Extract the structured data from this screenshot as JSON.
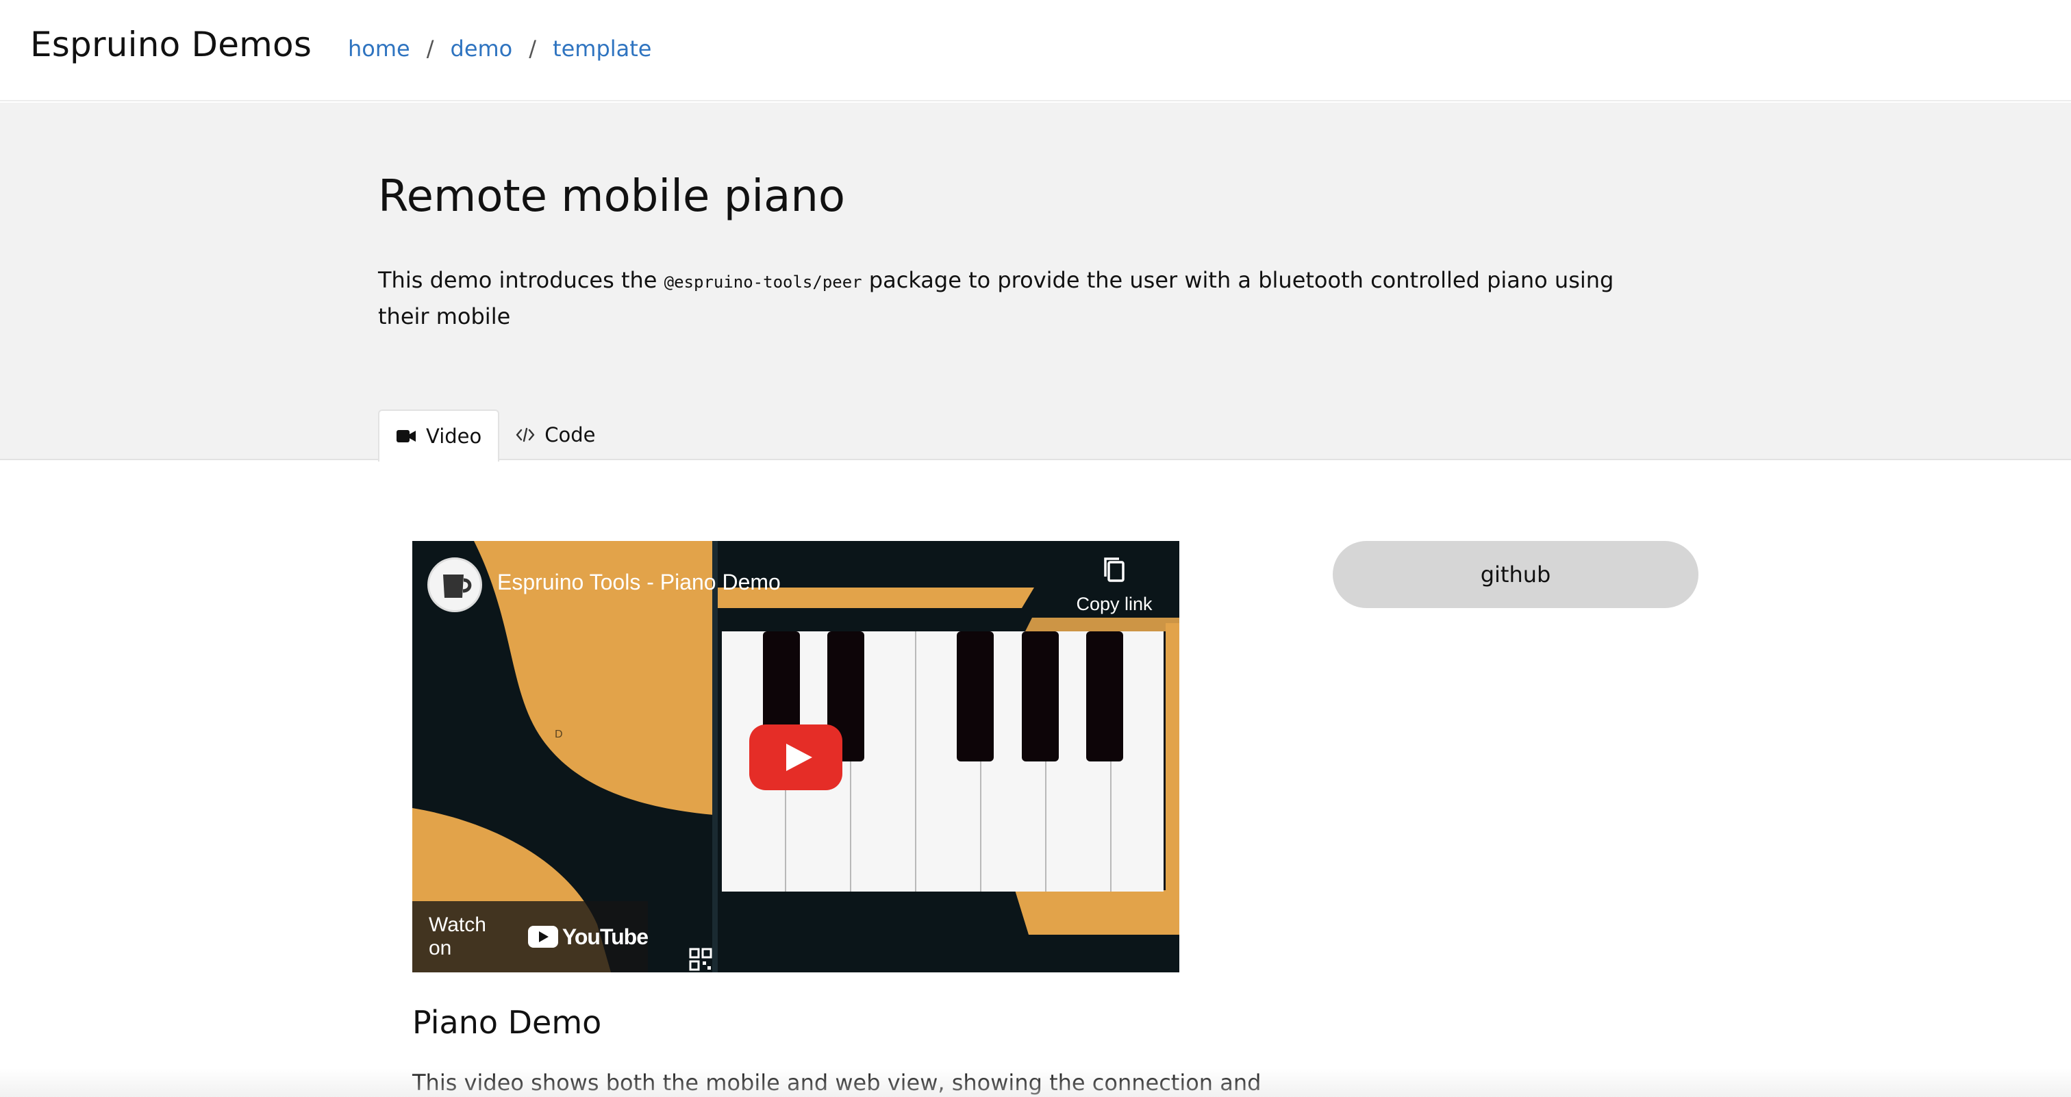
{
  "header": {
    "brand": "Espruino Demos",
    "breadcrumb": [
      {
        "label": "home"
      },
      {
        "label": "demo"
      },
      {
        "label": "template"
      }
    ],
    "separator": "/"
  },
  "hero": {
    "title": "Remote mobile piano",
    "intro_before": "This demo introduces the ",
    "intro_code": "@espruino-tools/peer",
    "intro_after": " package to provide the user with a bluetooth controlled piano using their mobile"
  },
  "tabs": [
    {
      "label": "Video",
      "icon": "video-camera-icon",
      "active": true
    },
    {
      "label": "Code",
      "icon": "code-icon",
      "active": false
    }
  ],
  "video": {
    "title": "Espruino Tools - Piano Demo",
    "copy_link_label": "Copy link",
    "watch_on_label": "Watch on",
    "youtube_label": "YouTube",
    "overlay_text": "D"
  },
  "sidebar": {
    "github_label": "github"
  },
  "section": {
    "title": "Piano Demo",
    "text": "This video shows both the mobile and web view, showing the connection and"
  },
  "colors": {
    "link": "#2f74c0",
    "hero_bg": "#f2f2f2",
    "button_bg": "#d6d6d6",
    "play_red": "#e52d27",
    "piano_orange": "#e2a34a"
  }
}
